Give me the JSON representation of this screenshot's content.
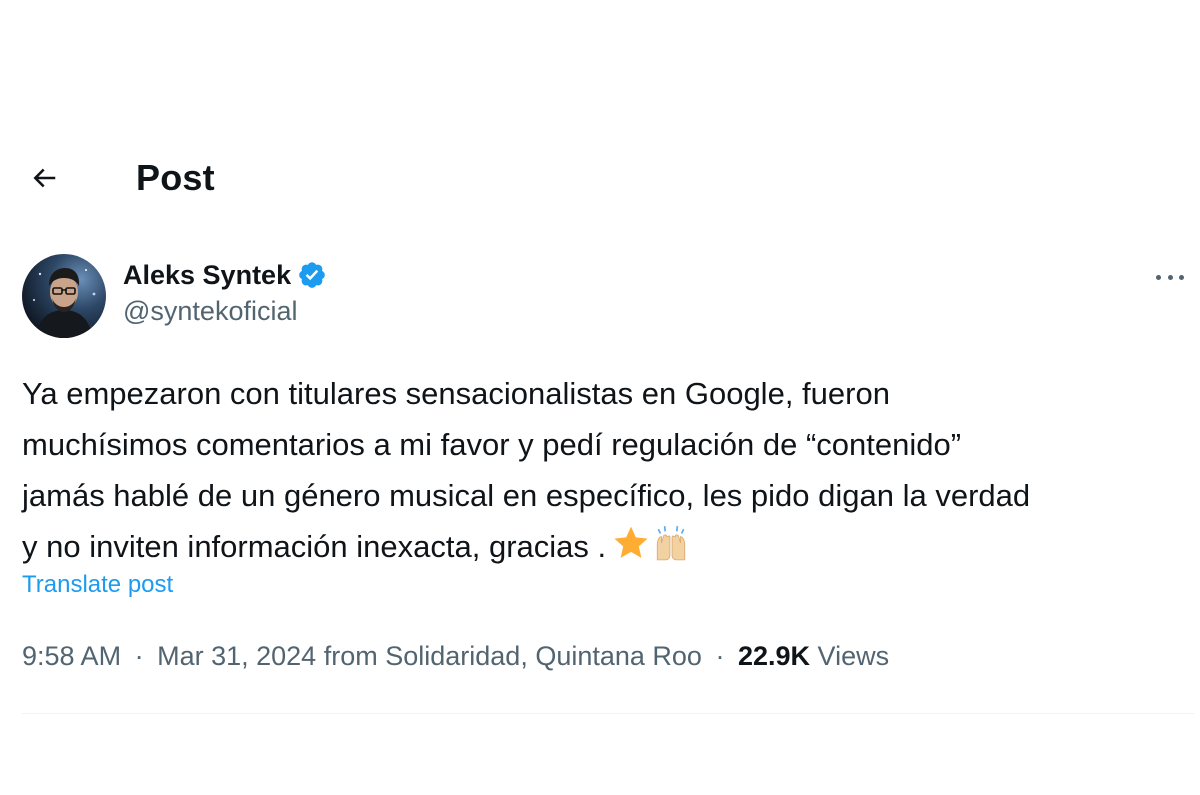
{
  "header": {
    "back_icon": "arrow-left-icon",
    "title": "Post"
  },
  "author": {
    "display_name": "Aleks Syntek",
    "handle": "@syntekoficial",
    "verified_icon": "verified-badge-icon",
    "verified_color": "#1d9bf0"
  },
  "more_icon": "more-horizontal-icon",
  "post": {
    "lines": [
      "Ya empezaron con titulares sensacionalistas en Google, fueron",
      "muchísimos comentarios a mi favor y pedí regulación de “contenido”",
      "jamás hablé de un género musical en específico, les pido digan la verdad",
      "y no inviten información inexacta, gracias ."
    ],
    "emojis": [
      "star-emoji",
      "raising-hands-emoji"
    ]
  },
  "translate_label": "Translate post",
  "meta": {
    "time": "9:58 AM",
    "date": "Mar 31, 2024",
    "location": "from Solidaridad, Quintana Roo",
    "separator": "·",
    "views_count": "22.9K",
    "views_label": "Views"
  },
  "colors": {
    "text_primary": "#0f1419",
    "text_secondary": "#536471",
    "link": "#1d9bf0",
    "divider": "#eff3f4"
  }
}
